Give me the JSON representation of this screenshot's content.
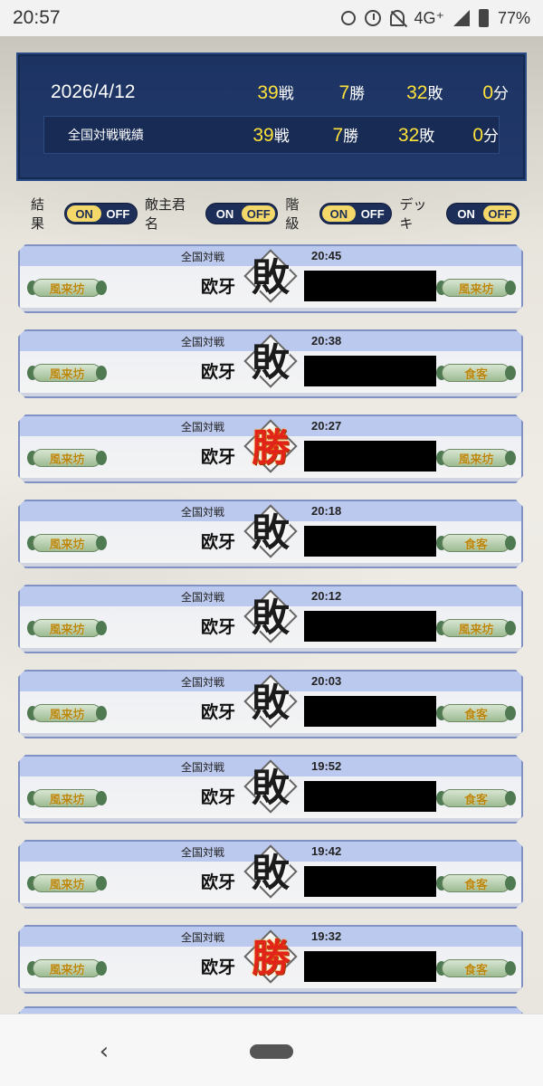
{
  "status_bar": {
    "time": "20:57",
    "network": "4G⁺",
    "battery": "77%"
  },
  "summary": {
    "row1": {
      "label": "2026/4/12",
      "battles": "39",
      "wins": "7",
      "losses": "32",
      "draws": "0"
    },
    "row2": {
      "label": "全国対戦戦績",
      "battles": "39",
      "wins": "7",
      "losses": "32",
      "draws": "0"
    },
    "units": {
      "battles": "戦",
      "wins": "勝",
      "losses": "敗",
      "draws": "分"
    }
  },
  "filters": {
    "result_label": "結果",
    "enemy_label": "敵主君名",
    "rank_label": "階級",
    "deck_label": "デッキ",
    "on": "ON",
    "off": "OFF"
  },
  "battles": [
    {
      "mode": "全国対戦",
      "time": "20:45",
      "player": "欧牙",
      "result": "敗",
      "left_badge": "風来坊",
      "right_badge": "風来坊"
    },
    {
      "mode": "全国対戦",
      "time": "20:38",
      "player": "欧牙",
      "result": "敗",
      "left_badge": "風来坊",
      "right_badge": "食客"
    },
    {
      "mode": "全国対戦",
      "time": "20:27",
      "player": "欧牙",
      "result": "勝",
      "left_badge": "風来坊",
      "right_badge": "風来坊"
    },
    {
      "mode": "全国対戦",
      "time": "20:18",
      "player": "欧牙",
      "result": "敗",
      "left_badge": "風来坊",
      "right_badge": "食客"
    },
    {
      "mode": "全国対戦",
      "time": "20:12",
      "player": "欧牙",
      "result": "敗",
      "left_badge": "風来坊",
      "right_badge": "風来坊"
    },
    {
      "mode": "全国対戦",
      "time": "20:03",
      "player": "欧牙",
      "result": "敗",
      "left_badge": "風来坊",
      "right_badge": "食客"
    },
    {
      "mode": "全国対戦",
      "time": "19:52",
      "player": "欧牙",
      "result": "敗",
      "left_badge": "風来坊",
      "right_badge": "食客"
    },
    {
      "mode": "全国対戦",
      "time": "19:42",
      "player": "欧牙",
      "result": "敗",
      "left_badge": "風来坊",
      "right_badge": "食客"
    },
    {
      "mode": "全国対戦",
      "time": "19:32",
      "player": "欧牙",
      "result": "勝",
      "left_badge": "風来坊",
      "right_badge": "食客"
    }
  ],
  "colors": {
    "panel_navy": "#1c3362",
    "stat_yellow": "#ffe23a",
    "win_red": "#e2231a",
    "row_header_blue": "#bcc9ee"
  }
}
